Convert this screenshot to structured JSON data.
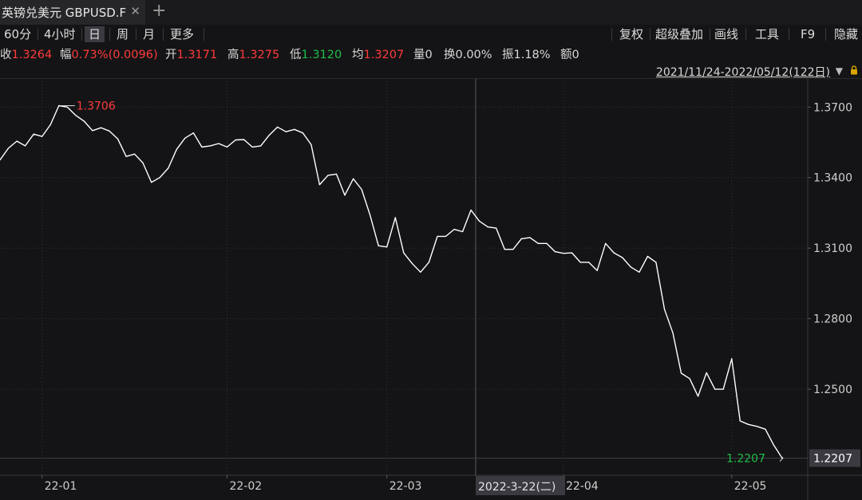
{
  "tab": {
    "title": "英镑兑美元 GBPUSD.F",
    "close_icon": "close-icon",
    "add_icon": "plus-icon"
  },
  "toolbar": {
    "periods": [
      "60分",
      "4小时",
      "日",
      "周",
      "月",
      "更多"
    ],
    "active_period": "日",
    "tools": [
      "复权",
      "超级叠加",
      "画线",
      "工具",
      "F9",
      "隐藏"
    ]
  },
  "quote": {
    "close_label": "收",
    "close_value": "1.3264",
    "range_label": "幅",
    "range_value": "0.73%(0.0096)",
    "open_label": "开",
    "open_value": "1.3171",
    "high_label": "高",
    "high_value": "1.3275",
    "low_label": "低",
    "low_value": "1.3120",
    "avg_label": "均",
    "avg_value": "1.3207",
    "vol_label": "量",
    "vol_value": "0",
    "turnover_label": "换",
    "turnover_value": "0.00%",
    "amp_label": "振",
    "amp_value": "1.18%",
    "amount_label": "额",
    "amount_value": "0"
  },
  "date_range": "2021/11/24-2022/05/12(122日)",
  "colors": {
    "up": "#ff3b3b",
    "down": "#1fbf4a",
    "line": "#ffffff",
    "grid": "#34343a",
    "bg": "#141416"
  },
  "cursor": {
    "date_label": "2022-3-22(二)",
    "date": "2022-03-22"
  },
  "chart_data": {
    "type": "line",
    "series": [
      {
        "values": [
          1.3475,
          1.3525,
          1.3555,
          1.3535,
          1.3585,
          1.3575,
          1.3625,
          1.3706,
          1.37,
          1.3665,
          1.364,
          1.36,
          1.3612,
          1.3598,
          1.3565,
          1.349,
          1.35,
          1.3462,
          1.338,
          1.34,
          1.344,
          1.352,
          1.3568,
          1.359,
          1.353,
          1.3535,
          1.3545,
          1.353,
          1.356,
          1.3562,
          1.353,
          1.3535,
          1.358,
          1.3615,
          1.3595,
          1.3605,
          1.359,
          1.354,
          1.337,
          1.341,
          1.3415,
          1.3325,
          1.3395,
          1.335,
          1.324,
          1.311,
          1.3105,
          1.323,
          1.308,
          1.3035,
          1.2998,
          1.304,
          1.315,
          1.315,
          1.318,
          1.317,
          1.3262,
          1.3215,
          1.319,
          1.3185,
          1.3095,
          1.3095,
          1.314,
          1.3145,
          1.312,
          1.312,
          1.3085,
          1.3078,
          1.308,
          1.304,
          1.304,
          1.3005,
          1.312,
          1.308,
          1.306,
          1.302,
          1.2998,
          1.3065,
          1.304,
          1.284,
          1.274,
          1.2568,
          1.2545,
          1.247,
          1.257,
          1.25,
          1.25,
          1.263,
          1.2365,
          1.235,
          1.2342,
          1.233,
          1.2262,
          1.2207
        ]
      }
    ],
    "ylim": [
      1.2134,
      1.3823
    ],
    "y_ticks": [
      "1.3700",
      "1.3400",
      "1.3100",
      "1.2800",
      "1.2500"
    ],
    "x_ticks": [
      "22-01",
      "22-02",
      "22-03",
      "22-04",
      "22-05"
    ],
    "max_label": "1.3706",
    "last_label": "1.2207",
    "last_value": "1.2207",
    "grid": true
  }
}
